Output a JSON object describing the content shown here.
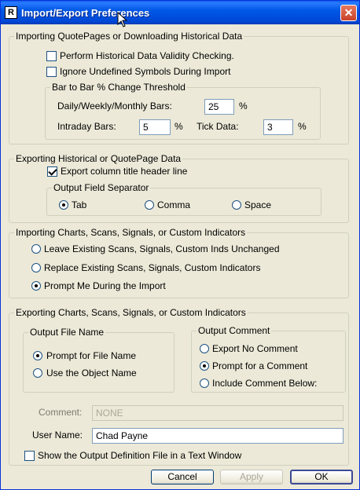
{
  "window": {
    "title": "Import/Export Preferences",
    "close_glyph": "✕",
    "icon_glyph": "R"
  },
  "import_quotepages": {
    "legend": "Importing QuotePages or Downloading Historical Data",
    "validity_check": {
      "label": "Perform Historical Data Validity Checking.",
      "checked": false
    },
    "ignore_undefined": {
      "label": "Ignore Undefined Symbols During Import",
      "checked": false
    },
    "threshold": {
      "legend": "Bar to Bar % Change Threshold",
      "daily_label": "Daily/Weekly/Monthly Bars:",
      "daily_value": "25",
      "intraday_label": "Intraday Bars:",
      "intraday_value": "5",
      "tick_label": "Tick Data:",
      "tick_value": "3",
      "percent": "%"
    }
  },
  "export_historical": {
    "legend": "Exporting Historical or QuotePage Data",
    "header_line": {
      "label": "Export column title header line",
      "checked": true
    },
    "separator": {
      "legend": "Output Field Separator",
      "options": [
        "Tab",
        "Comma",
        "Space"
      ],
      "selected": "Tab"
    }
  },
  "import_charts": {
    "legend": "Importing Charts, Scans, Signals, or Custom Indicators",
    "options": [
      "Leave Existing Scans, Signals, Custom Inds Unchanged",
      "Replace Existing Scans, Signals, Custom Indicators",
      "Prompt Me During the Import"
    ],
    "selected": "Prompt Me During the Import"
  },
  "export_charts": {
    "legend": "Exporting Charts, Scans, Signals, or Custom Indicators",
    "file_name": {
      "legend": "Output File Name",
      "options": [
        "Prompt for File Name",
        "Use the Object Name"
      ],
      "selected": "Prompt for File Name"
    },
    "comment": {
      "legend": "Output Comment",
      "options": [
        "Export No Comment",
        "Prompt for a Comment",
        "Include Comment Below:"
      ],
      "selected": "Prompt for a Comment"
    },
    "comment_label": "Comment:",
    "comment_value": "NONE",
    "user_label": "User Name:",
    "user_value": "Chad Payne",
    "show_definition": {
      "label": "Show the Output Definition File in a Text Window",
      "checked": false
    }
  },
  "buttons": {
    "cancel": "Cancel",
    "apply": "Apply",
    "ok": "OK"
  }
}
